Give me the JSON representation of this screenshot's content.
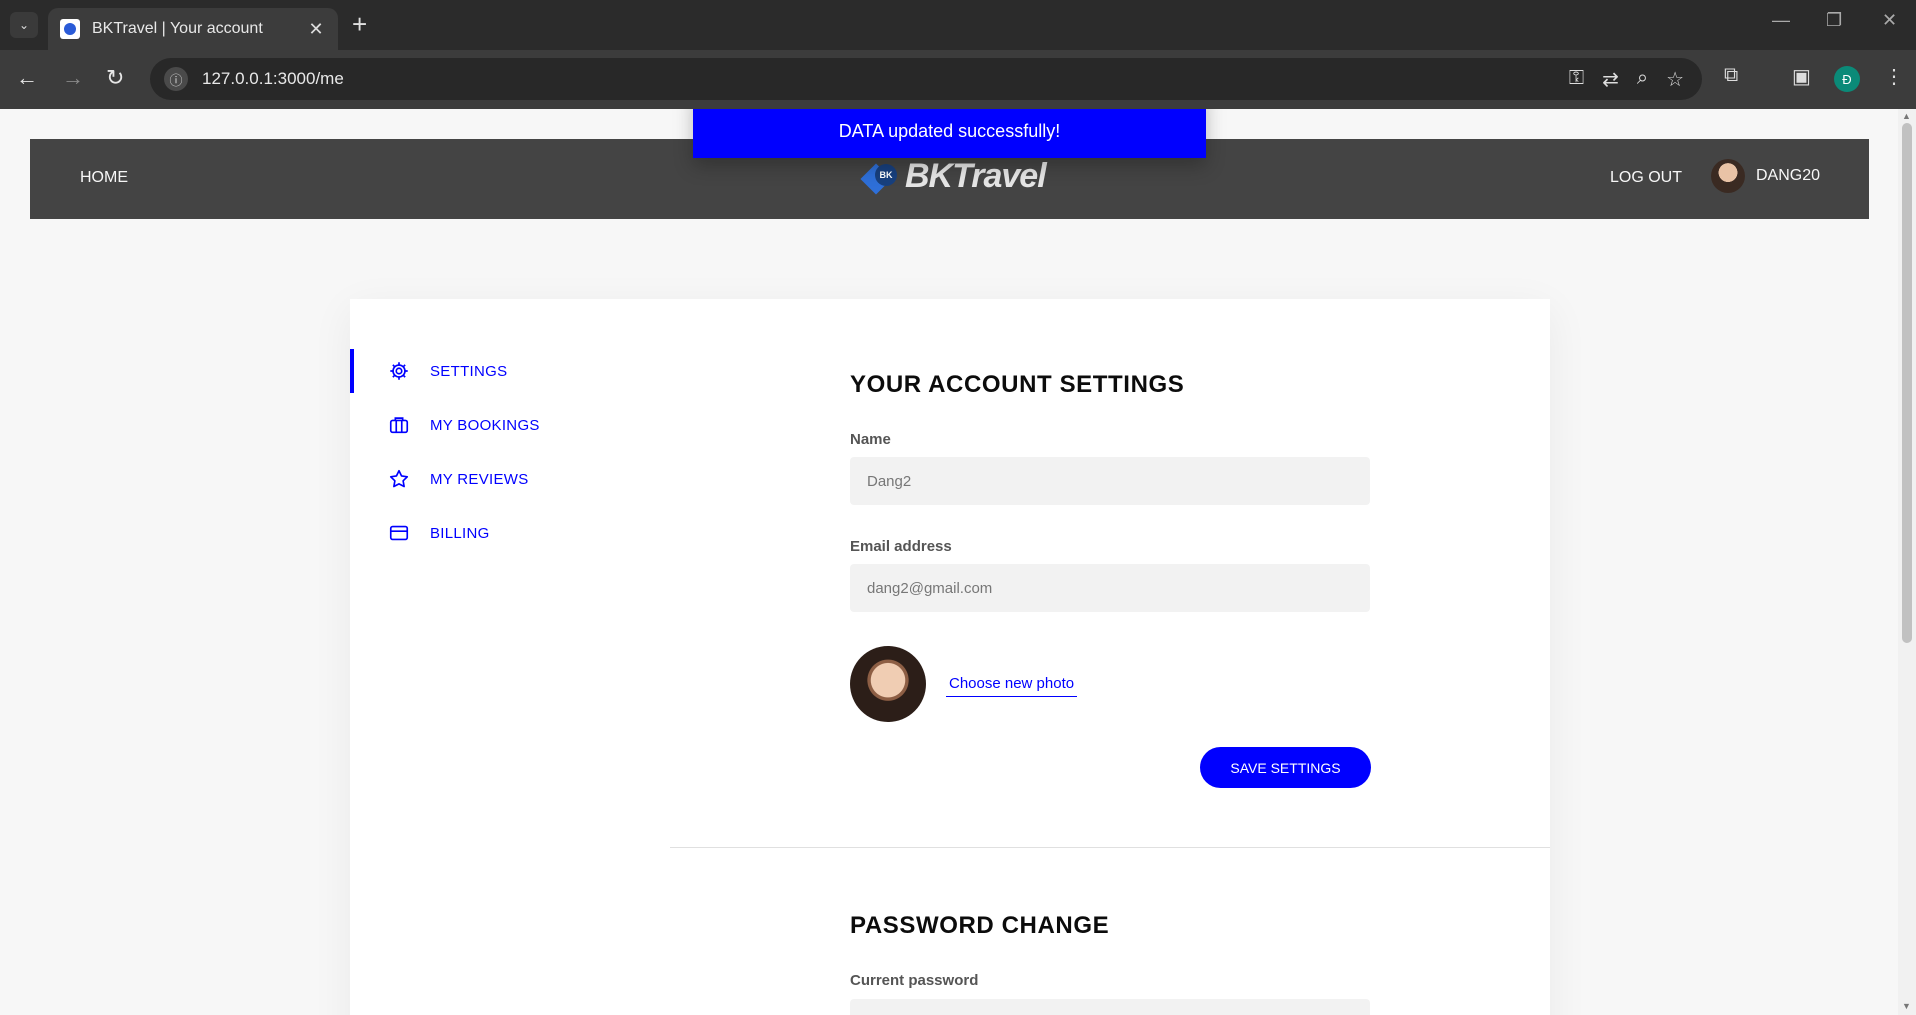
{
  "browser": {
    "tab_title": "BKTravel | Your account",
    "url": "127.0.0.1:3000/me",
    "profile_initial": "Đ"
  },
  "header": {
    "home": "HOME",
    "logo_badge": "BK",
    "logo_text": "BKTravel",
    "logout": "LOG OUT",
    "username": "DANG20"
  },
  "toast": {
    "message": "DATA updated successfully!"
  },
  "sidebar": {
    "items": [
      {
        "label": "SETTINGS",
        "icon": "settings-icon",
        "active": true
      },
      {
        "label": "MY BOOKINGS",
        "icon": "briefcase-icon",
        "active": false
      },
      {
        "label": "MY REVIEWS",
        "icon": "star-icon",
        "active": false
      },
      {
        "label": "BILLING",
        "icon": "credit-card-icon",
        "active": false
      }
    ]
  },
  "settings": {
    "title": "YOUR ACCOUNT SETTINGS",
    "name_label": "Name",
    "name_value": "Dang2",
    "email_label": "Email address",
    "email_value": "dang2@gmail.com",
    "choose_photo": "Choose new photo",
    "save_button": "SAVE SETTINGS"
  },
  "password": {
    "title": "PASSWORD CHANGE",
    "current_label": "Current password"
  },
  "colors": {
    "accent": "#0000ff",
    "header_bg": "#444444",
    "page_bg": "#f7f7f7"
  }
}
